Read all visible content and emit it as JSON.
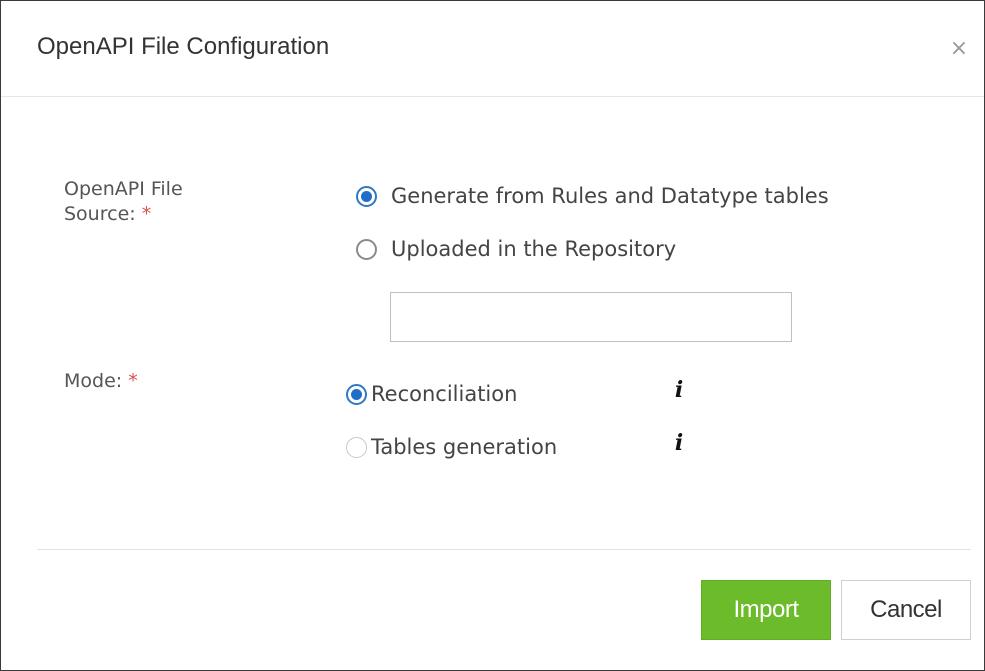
{
  "dialog": {
    "title": "OpenAPI File Configuration",
    "close_label": "×"
  },
  "form": {
    "source": {
      "label_line1": "OpenAPI File",
      "label_line2": "Source:",
      "required_mark": "*",
      "options": [
        {
          "label": "Generate from Rules and Datatype tables",
          "selected": true
        },
        {
          "label": "Uploaded in the Repository",
          "selected": false
        }
      ],
      "file_input": {
        "value": "",
        "placeholder": ""
      }
    },
    "mode": {
      "label": "Mode:",
      "required_mark": "*",
      "options": [
        {
          "label": "Reconciliation",
          "selected": true,
          "info_icon": "i"
        },
        {
          "label": "Tables generation",
          "selected": false,
          "info_icon": "i"
        }
      ]
    }
  },
  "footer": {
    "import_label": "Import",
    "cancel_label": "Cancel"
  },
  "colors": {
    "accent": "#1f6fc8",
    "import_button": "#6cbb2b",
    "required": "#d9534f"
  },
  "icons": {
    "close": "close-icon",
    "info": "info-icon"
  }
}
